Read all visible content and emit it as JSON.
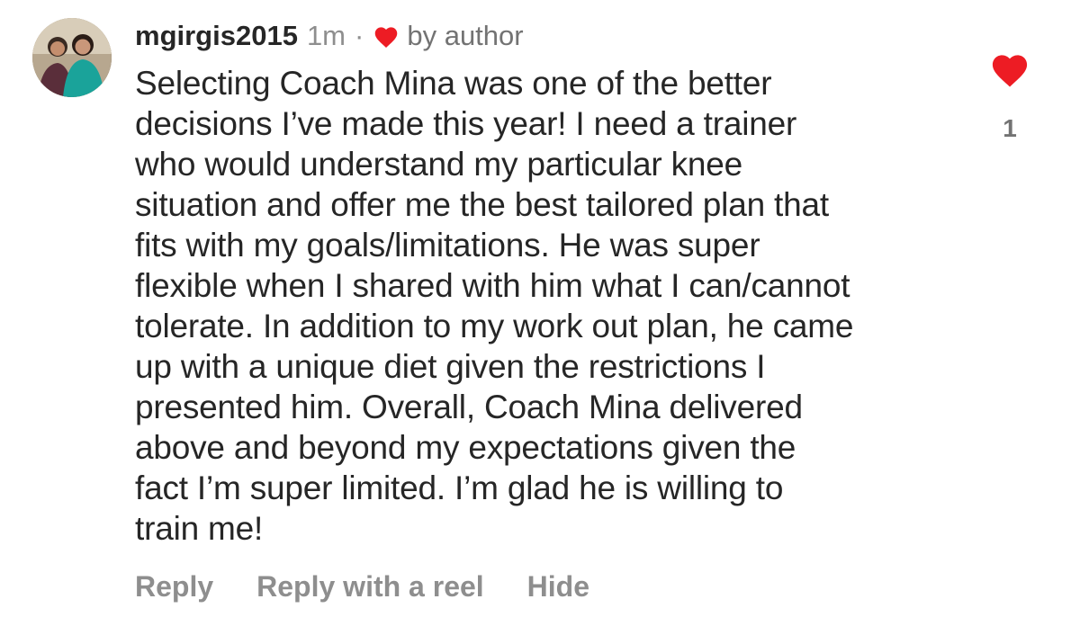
{
  "comment": {
    "username": "mgirgis2015",
    "time": "1m",
    "separator": "·",
    "author_badge": "by author",
    "text": "Selecting Coach Mina was one of the better\ndecisions I’ve made this year! I need a trainer\nwho would understand my particular knee\nsituation and offer me the best tailored plan that\nfits with my goals/limitations. He was super\nflexible when I shared with him what I can/cannot\ntolerate. In addition to my work out plan, he came\nup with a unique diet given the restrictions I\npresented him. Overall, Coach Mina delivered\nabove and beyond my expectations given the\nfact I’m super limited. I’m glad he is willing to\ntrain me!",
    "like_count": "1",
    "liked": true
  },
  "actions": {
    "reply": "Reply",
    "reply_reel": "Reply with a reel",
    "hide": "Hide"
  },
  "icons": {
    "author_heart": "heart-filled-icon",
    "like": "heart-filled-icon"
  },
  "colors": {
    "heart": "#ed1c24",
    "text": "#262626",
    "muted": "#8e8e8e"
  }
}
